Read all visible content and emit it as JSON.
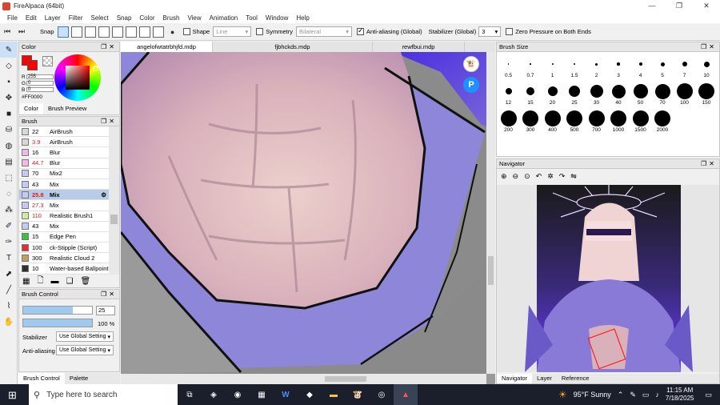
{
  "window": {
    "title": "FireAlpaca (64bit)",
    "minimize": "—",
    "restore": "❐",
    "close": "✕"
  },
  "menu": [
    "File",
    "Edit",
    "Layer",
    "Filter",
    "Select",
    "Snap",
    "Color",
    "Brush",
    "View",
    "Animation",
    "Tool",
    "Window",
    "Help"
  ],
  "toolbar": {
    "snap_label": "Snap",
    "shape_label": "Shape",
    "shape_value": "Line",
    "symmetry_label": "Symmetry",
    "symmetry_value": "Bilateral",
    "antialias_label": "Anti-aliasing (Global)",
    "stabilizer_label": "Stabilizer (Global)",
    "stabilizer_value": "3",
    "zero_pressure_label": "Zero Pressure on Both Ends"
  },
  "color_panel": {
    "title": "Color",
    "r_label": "R",
    "r_value": "255",
    "g_label": "G",
    "g_value": "0",
    "b_label": "B",
    "b_value": "0",
    "hex": "#FF0000",
    "tab_color": "Color",
    "tab_preview": "Brush Preview",
    "current_color": "#ff0000"
  },
  "brush_panel": {
    "title": "Brush",
    "items": [
      {
        "size": "22",
        "name": "AirBrush",
        "color": "#d8d8d8",
        "red": false
      },
      {
        "size": "3.9",
        "name": "AirBrush",
        "color": "#d8d8d8",
        "red": true
      },
      {
        "size": "16",
        "name": "Blur",
        "color": "#f4b8e6",
        "red": false
      },
      {
        "size": "44.7",
        "name": "Blur",
        "color": "#f4b8e6",
        "red": true
      },
      {
        "size": "70",
        "name": "Mix2",
        "color": "#c8c8f4",
        "red": false
      },
      {
        "size": "43",
        "name": "Mix",
        "color": "#c8c8f4",
        "red": false
      },
      {
        "size": "25.8",
        "name": "Mix",
        "color": "#c8c8f4",
        "red": true
      },
      {
        "size": "27.3",
        "name": "Mix",
        "color": "#c8c8f4",
        "red": true
      },
      {
        "size": "110",
        "name": "Realistic Brush1",
        "color": "#c8f0a0",
        "red": true
      },
      {
        "size": "43",
        "name": "Mix",
        "color": "#c8c8f4",
        "red": false
      },
      {
        "size": "15",
        "name": "Edge Pen",
        "color": "#40c040",
        "red": false
      },
      {
        "size": "100",
        "name": "ck-Stipple (Script)",
        "color": "#e03030",
        "red": false
      },
      {
        "size": "300",
        "name": "Realistic Cloud 2",
        "color": "#c0a060",
        "red": false
      },
      {
        "size": "10",
        "name": "Water-based Ballpoint",
        "color": "#303030",
        "red": false
      }
    ]
  },
  "brush_control": {
    "title": "Brush Control",
    "size_value": "25",
    "opacity_value": "100 %",
    "size_fill": 0.72,
    "opacity_fill": 1.0,
    "stabilizer_label": "Stabilizer",
    "stabilizer_value": "Use Global Setting",
    "antialias_label": "Anti-aliasing",
    "antialias_value": "Use Global Setting"
  },
  "bottom_tabs": [
    "Brush Control",
    "Palette"
  ],
  "doc_tabs": [
    "angelofwtatrbhjfd.mdp",
    "fjbhckds.mdp",
    "rewfbui.mdp"
  ],
  "brush_size": {
    "title": "Brush Size",
    "sizes": [
      "0.5",
      "0.7",
      "1",
      "1.5",
      "2",
      "3",
      "4",
      "5",
      "7",
      "10",
      "12",
      "15",
      "20",
      "25",
      "30",
      "40",
      "50",
      "70",
      "100",
      "150",
      "200",
      "300",
      "400",
      "500",
      "700",
      "1000",
      "1500",
      "2000"
    ]
  },
  "navigator": {
    "title": "Navigator",
    "tabs": [
      "Navigator",
      "Layer",
      "Reference"
    ]
  },
  "taskbar": {
    "search_placeholder": "Type here to search",
    "weather": "95°F  Sunny",
    "time": "11:15 AM",
    "date": "7/18/2025"
  }
}
